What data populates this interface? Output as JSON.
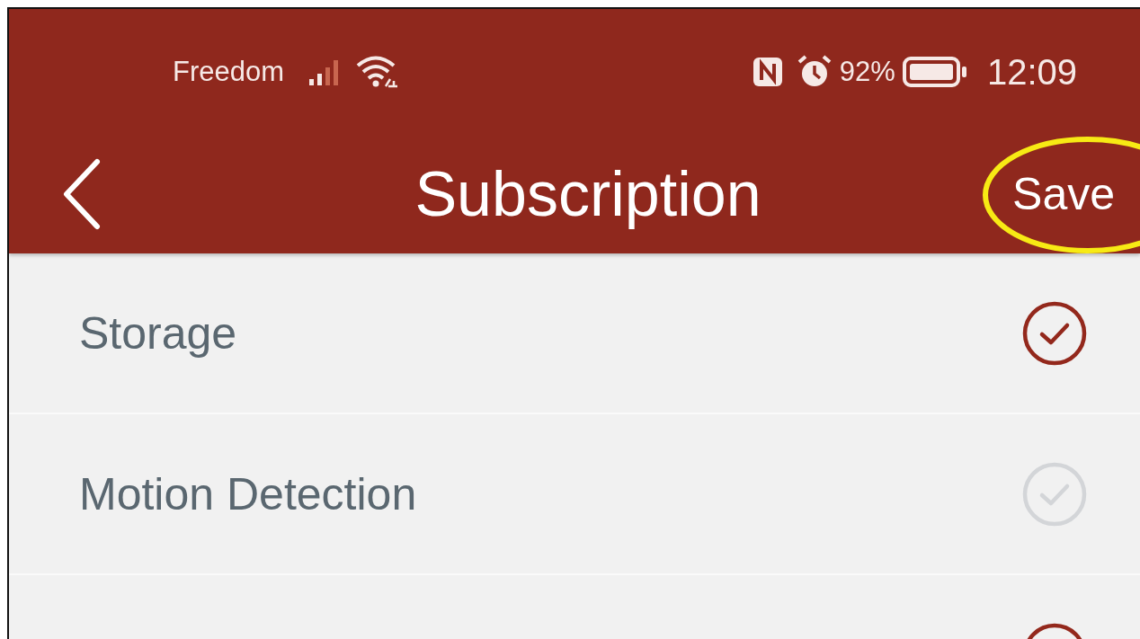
{
  "status_bar": {
    "carrier": "Freedom",
    "battery": "92%",
    "time": "12:09"
  },
  "nav": {
    "title": "Subscription",
    "action": "Save"
  },
  "items": [
    {
      "label": "Storage",
      "checked": true
    },
    {
      "label": "Motion Detection",
      "checked": false
    },
    {
      "checked": true
    }
  ]
}
